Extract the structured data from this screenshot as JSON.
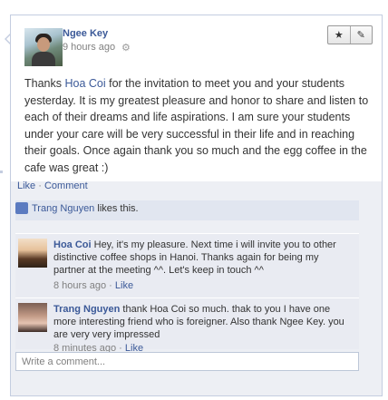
{
  "post": {
    "author": "Ngee Key",
    "time": "9 hours ago",
    "gear_icon": "⚙",
    "star_icon": "★",
    "edit_icon": "✎",
    "text_before": "Thanks ",
    "mention": "Hoa Coi",
    "text_after": " for the invitation to meet you and your students yesterday. It is my greatest pleasure and honor to share and listen to each of their dreams and life aspirations. I am sure your students under your care will be very successful in their life and in reaching their goals. Once again thank you so much and the egg coffee in the cafe was great :)"
  },
  "actions": {
    "like": "Like",
    "separator": " · ",
    "comment": "Comment"
  },
  "likes": {
    "name": "Trang Nguyen",
    "text": " likes this."
  },
  "comments": [
    {
      "name": "Hoa Coi",
      "text": "Hey, it's my pleasure. Next time i will invite you to other distinctive coffee shops in Hanoi. Thanks again for being my partner at the meeting ^^. Let's keep in touch ^^",
      "time": "8 hours ago",
      "like": "Like"
    },
    {
      "name": "Trang Nguyen",
      "text": "thank Hoa Coi so much. thak to you I have one more interesting friend who is foreigner. Also thank Ngee Key. you are very very impressed",
      "time": "8 minutes ago",
      "like": "Like"
    }
  ],
  "comment_input": {
    "placeholder": "Write a comment..."
  },
  "colors": {
    "link": "#3b5998",
    "footer_bg": "#edeff4",
    "comment_bg": "#e9ebf2"
  }
}
